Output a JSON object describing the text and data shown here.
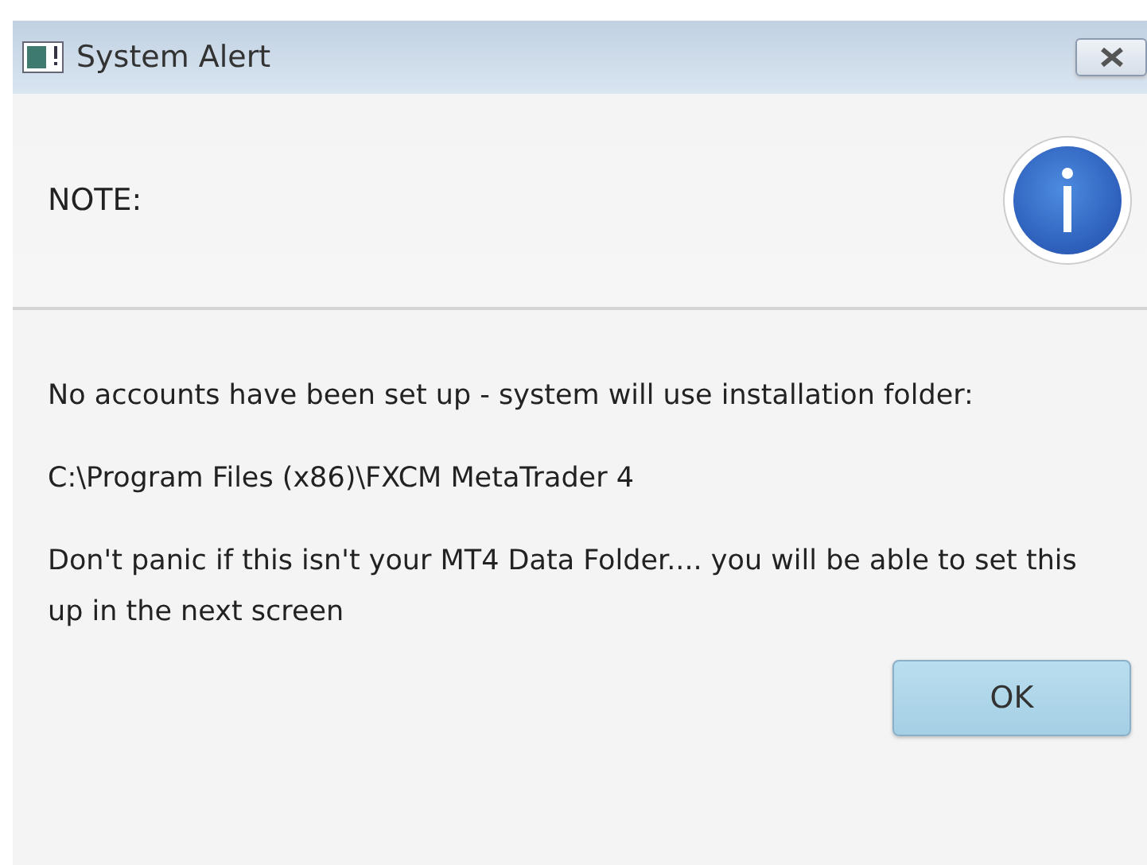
{
  "window": {
    "title": "System Alert"
  },
  "header": {
    "text": "NOTE:"
  },
  "message": [
    "No accounts have been set up - system will use installation folder:",
    "C:\\Program Files (x86)\\FXCM MetaTrader 4",
    "Don't panic if this isn't your MT4 Data Folder.... you will be able to set this up in the next screen"
  ],
  "buttons": [
    "OK"
  ]
}
